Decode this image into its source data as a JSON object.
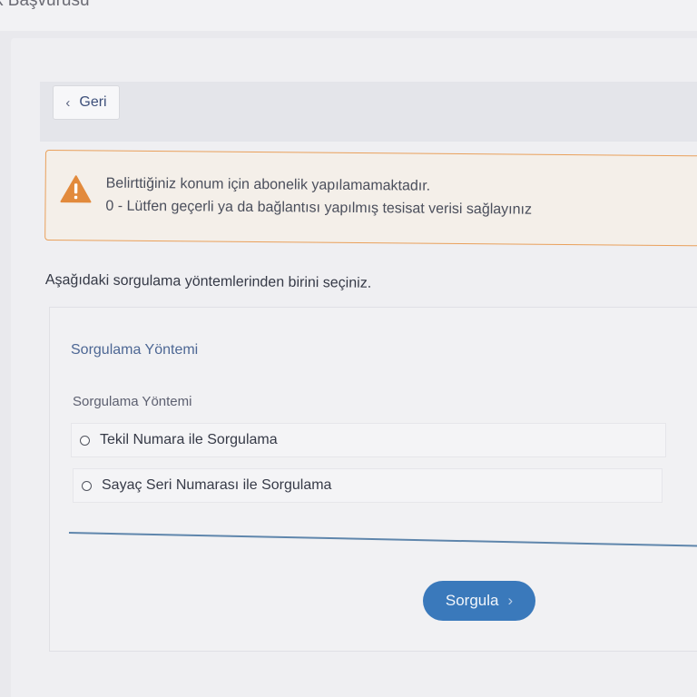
{
  "header": {
    "page_title": "k Başvurusu"
  },
  "toolbar": {
    "back_label": "Geri",
    "back_icon": "chevron-left-icon"
  },
  "alert": {
    "icon": "warning-icon",
    "message": "Belirttiğiniz konum için abonelik yapılamamaktadır.",
    "detail": "0 - Lütfen geçerli ya da bağlantısı yapılmış tesisat verisi sağlayınız",
    "border_color": "#e9a05b",
    "icon_color": "#e28a3c"
  },
  "main": {
    "instruction": "Aşağıdaki sorgulama yöntemlerinden birini seçiniz.",
    "card": {
      "title": "Sorgulama Yöntemi",
      "field_label": "Sorgulama Yöntemi",
      "options": [
        {
          "label": "Tekil Numara ile Sorgulama",
          "selected": false
        },
        {
          "label": "Sayaç Seri Numarası ile Sorgulama",
          "selected": false
        }
      ]
    },
    "submit": {
      "label": "Sorgula",
      "icon": "chevron-right-icon",
      "color": "#3a79bb"
    }
  }
}
